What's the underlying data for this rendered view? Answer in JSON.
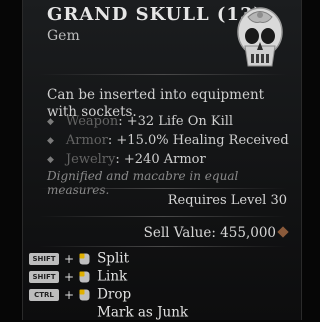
{
  "item": {
    "title": "GRAND SKULL (13)",
    "type": "Gem",
    "description": "Can be inserted into equipment with sockets.",
    "stats": [
      {
        "slot": "Weapon",
        "value": ": +32 Life On Kill"
      },
      {
        "slot": "Armor",
        "value": ": +15.0% Healing Received"
      },
      {
        "slot": "Jewelry",
        "value": ": +240 Armor"
      }
    ],
    "flavor": "Dignified and macabre in equal measures.",
    "requires": "Requires Level 30",
    "sell_value": "Sell Value: 455,000",
    "icon": "skull-gem-icon"
  },
  "actions": [
    {
      "key": "SHIFT",
      "mouse": "left-click-icon",
      "label": "Split"
    },
    {
      "key": "SHIFT",
      "mouse": "left-click-icon",
      "label": "Link"
    },
    {
      "key": "CTRL",
      "mouse": "left-click-icon",
      "label": "Drop"
    },
    {
      "key": "",
      "mouse": "",
      "label": "Mark as Junk"
    }
  ],
  "colors": {
    "background": "#060606",
    "panel": "#1b1d1f",
    "slot_text": "#636363",
    "gold": "#8a5a3a"
  }
}
